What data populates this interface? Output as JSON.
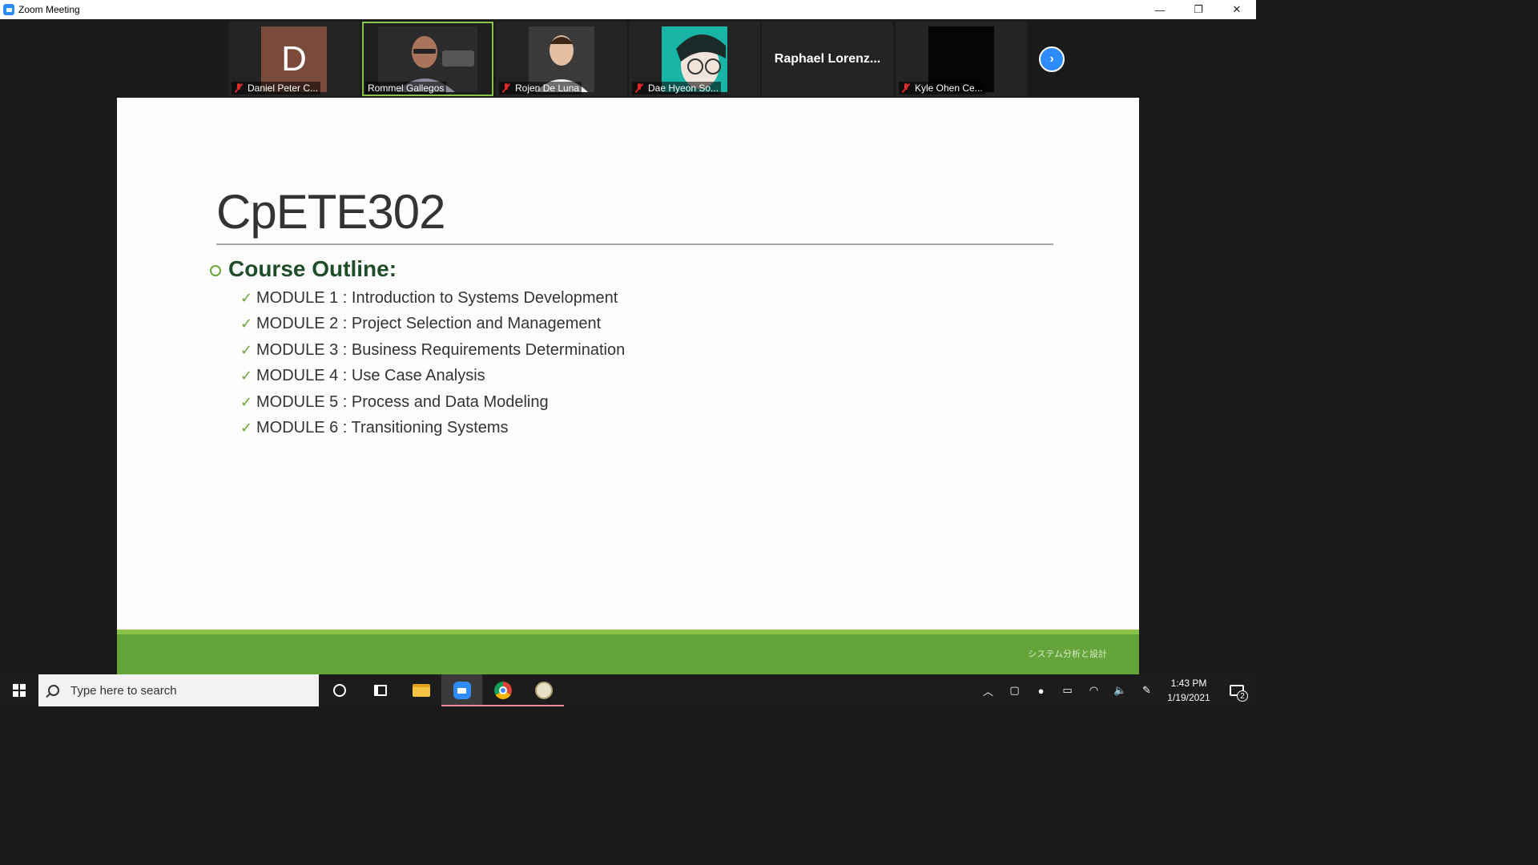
{
  "window": {
    "title": "Zoom Meeting",
    "controls": {
      "minimize": "—",
      "restore": "❐",
      "close": "✕"
    }
  },
  "participants": [
    {
      "name": "Daniel Peter C...",
      "avatar_letter": "D",
      "muted": true,
      "video": false
    },
    {
      "name": "Rommel Gallegos",
      "muted": false,
      "video": true,
      "active_speaker": true
    },
    {
      "name": "Rojen De Luna",
      "muted": true,
      "video": true
    },
    {
      "name": "Dae Hyeon So...",
      "muted": true,
      "video": true
    },
    {
      "name": "Raphael  Lorenz...",
      "muted": false,
      "video": false
    },
    {
      "name": "Kyle Ohen Ce...",
      "muted": true,
      "video": true
    }
  ],
  "next_page_icon": "chevron-right-icon",
  "slide": {
    "title": "CpETE302",
    "outline_heading": "Course Outline:",
    "modules": [
      "MODULE 1 : Introduction to Systems Development",
      "MODULE 2 : Project Selection and Management",
      "MODULE 3 : Business Requirements Determination",
      "MODULE 4 : Use Case Analysis",
      "MODULE 5 : Process and Data Modeling",
      "MODULE 6 : Transitioning Systems"
    ],
    "footer_text": "システム分析と設計",
    "colors": {
      "accent_green": "#65a33b",
      "heading_green": "#1f4d2a",
      "check_green": "#6aa53a"
    }
  },
  "taskbar": {
    "search_placeholder": "Type here to search",
    "apps": [
      "cortana-icon",
      "task-view-icon",
      "file-explorer-icon",
      "zoom-icon",
      "chrome-icon",
      "paint-icon"
    ],
    "clock": {
      "time": "1:43 PM",
      "date": "1/19/2021"
    },
    "notification_count": "2"
  }
}
